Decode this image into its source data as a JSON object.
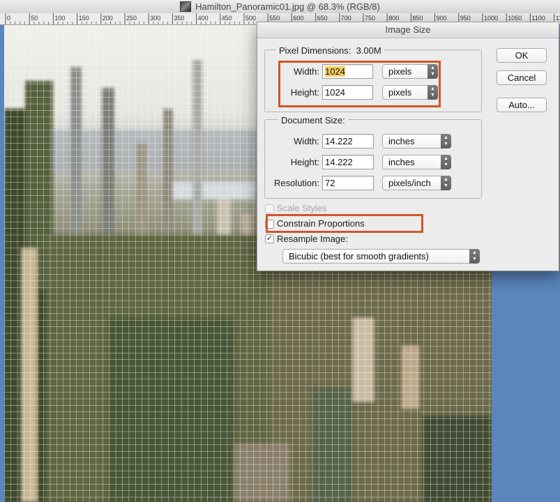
{
  "window": {
    "title": "Hamilton_Panoramic01.jpg @ 68.3% (RGB/8)",
    "icon": "document-thumbnail-icon"
  },
  "ruler": {
    "labels": [
      "0",
      "50",
      "100",
      "150",
      "200",
      "250",
      "300",
      "350",
      "400",
      "450",
      "500",
      "550",
      "600",
      "650",
      "700",
      "750",
      "800",
      "850",
      "900",
      "950",
      "1000",
      "1050",
      "1100",
      "1150"
    ]
  },
  "dialog": {
    "title": "Image Size",
    "pixel_dimensions": {
      "label": "Pixel Dimensions:",
      "size": "3.00M",
      "width_label": "Width:",
      "width_value": "1024",
      "width_unit": "pixels",
      "height_label": "Height:",
      "height_value": "1024",
      "height_unit": "pixels"
    },
    "document_size": {
      "label": "Document Size:",
      "width_label": "Width:",
      "width_value": "14.222",
      "width_unit": "inches",
      "height_label": "Height:",
      "height_value": "14.222",
      "height_unit": "inches",
      "resolution_label": "Resolution:",
      "resolution_value": "72",
      "resolution_unit": "pixels/inch"
    },
    "options": {
      "scale_styles": "Scale Styles",
      "scale_styles_checked": false,
      "constrain_proportions": "Constrain Proportions",
      "constrain_checked": false,
      "resample_image": "Resample Image:",
      "resample_checked": true,
      "resample_method": "Bicubic (best for smooth gradients)"
    },
    "buttons": {
      "ok": "OK",
      "cancel": "Cancel",
      "auto": "Auto..."
    }
  },
  "colors": {
    "desktop": "#5a86bd",
    "annotation": "#d2552a",
    "text_selection": "#f1cf63"
  }
}
